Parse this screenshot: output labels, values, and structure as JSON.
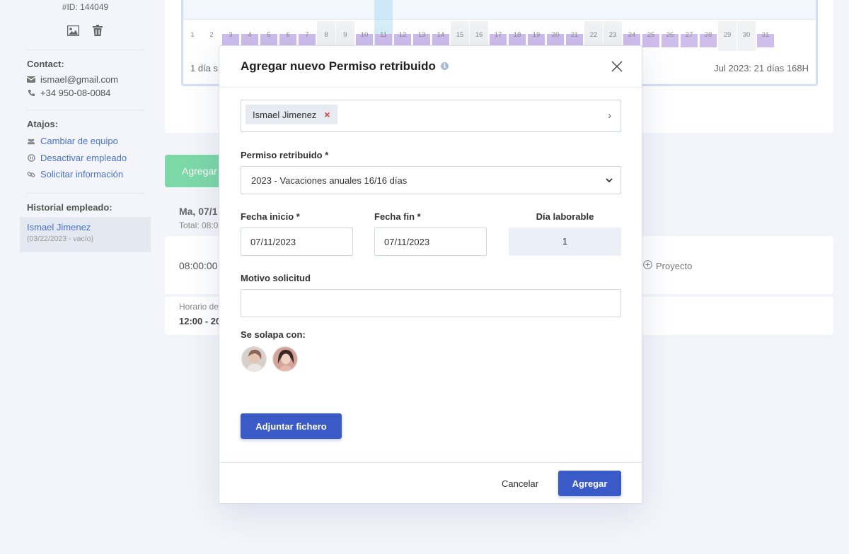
{
  "sidebar": {
    "emp_id": "#ID: 144049",
    "contact_title": "Contact:",
    "email": "ismael@gmail.com",
    "phone": "+34 950-08-0084",
    "shortcuts_title": "Atajos:",
    "shortcuts": [
      "Cambiar de equipo",
      "Desactivar empleado",
      "Solicitar información"
    ],
    "history_title": "Historial empleado:",
    "history_name": "Ismael Jimenez",
    "history_range": "(03/22/2023 - vacío)"
  },
  "calendar": {
    "days": [
      "1",
      "2",
      "3",
      "4",
      "5",
      "6",
      "7",
      "8",
      "9",
      "10",
      "11",
      "12",
      "13",
      "14",
      "15",
      "16",
      "17",
      "18",
      "19",
      "20",
      "21",
      "22",
      "23",
      "24",
      "25",
      "26",
      "27",
      "28",
      "29",
      "30",
      "31"
    ],
    "footer_left": "1 día s",
    "footer_right": "Jul 2023: 21 días 168H"
  },
  "background": {
    "add_button": "Agregar",
    "day_heading": "Ma, 07/1",
    "day_total": "Total: 08:0",
    "row_time": "08:00:00",
    "project_label": "Proyecto",
    "schedule_label": "Horario de",
    "schedule_value": "12:00 - 20"
  },
  "modal": {
    "title": "Agregar nuevo Permiso retribuido",
    "employee_chip": "Ismael Jimenez",
    "leave_type_label": "Permiso retribuido *",
    "leave_type_value": "2023 - Vacaciones anuales 16/16 días",
    "start_label": "Fecha inicio *",
    "start_value": "07/11/2023",
    "end_label": "Fecha fin *",
    "end_value": "07/11/2023",
    "workday_label": "Día laborable",
    "workday_value": "1",
    "reason_label": "Motivo solicitud",
    "reason_value": "",
    "overlap_label": "Se solapa con:",
    "attach_button": "Adjuntar fichero",
    "cancel_button": "Cancelar",
    "submit_button": "Agregar"
  },
  "colors": {
    "primary": "#3a5bc7",
    "link": "#4a72c6",
    "success": "#7dd8a7",
    "leave_bar": "#cfbdec",
    "remove": "#e03a3a"
  }
}
